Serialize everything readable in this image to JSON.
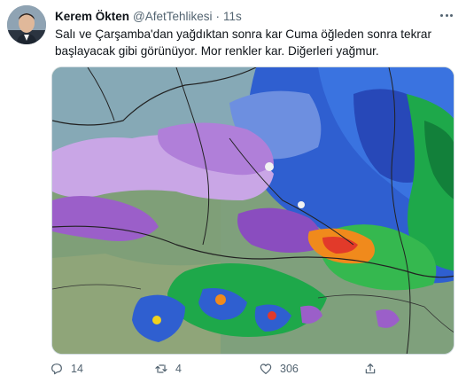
{
  "tweet": {
    "author_name": "Kerem Ökten",
    "author_handle": "@AfetTehlikesi",
    "separator": "·",
    "time": "11s",
    "text_line1": "Salı ve Çarşamba'dan yağdıktan sonra kar Cuma öğleden sonra tekrar",
    "text_line2": "başlayacak gibi görünüyor. Mor renkler kar. Diğerleri yağmur.",
    "media": {
      "type": "precipitation-radar-map",
      "snow_color": "#9b5fc9",
      "rain_colors": [
        "#2f5fd0",
        "#1ea84a",
        "#f08a1c",
        "#e23a2a"
      ]
    }
  },
  "actions": {
    "reply": {
      "icon": "reply-icon",
      "count": "14"
    },
    "retweet": {
      "icon": "retweet-icon",
      "count": "4"
    },
    "like": {
      "icon": "heart-icon",
      "count": "306"
    },
    "share": {
      "icon": "share-icon"
    }
  },
  "colors": {
    "text": "#0f1419",
    "secondary": "#536471",
    "border": "#cfd9de"
  }
}
